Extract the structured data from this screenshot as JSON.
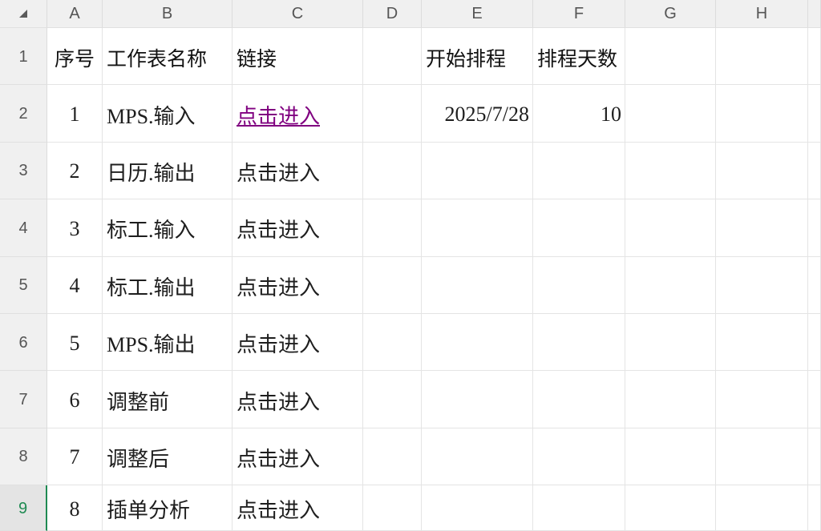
{
  "icons": {
    "corner": "select-all-triangle-icon"
  },
  "colors": {
    "link_visited": "#800080",
    "selected_row_accent": "#1f8a52",
    "gridline": "#e4e4e4",
    "header_background": "#f0f0f0"
  },
  "selection": {
    "row": 9
  },
  "column_headers": [
    "A",
    "B",
    "C",
    "D",
    "E",
    "F",
    "G",
    "H"
  ],
  "row_headers": [
    "1",
    "2",
    "3",
    "4",
    "5",
    "6",
    "7",
    "8",
    "9"
  ],
  "rows": [
    {
      "A": "序号",
      "B": "工作表名称",
      "C": "链接",
      "E": "开始排程",
      "F": "排程天数"
    },
    {
      "A": "1",
      "B": "MPS.输入",
      "C": "点击进入",
      "E": "2025/7/28",
      "F": "10"
    },
    {
      "A": "2",
      "B": "日历.输出",
      "C": "点击进入"
    },
    {
      "A": "3",
      "B": "标工.输入",
      "C": "点击进入"
    },
    {
      "A": "4",
      "B": "标工.输出",
      "C": "点击进入"
    },
    {
      "A": "5",
      "B": "MPS.输出",
      "C": "点击进入"
    },
    {
      "A": "6",
      "B": "调整前",
      "C": "点击进入"
    },
    {
      "A": "7",
      "B": "调整后",
      "C": "点击进入"
    },
    {
      "A": "8",
      "B": "插单分析",
      "C": "点击进入"
    }
  ]
}
